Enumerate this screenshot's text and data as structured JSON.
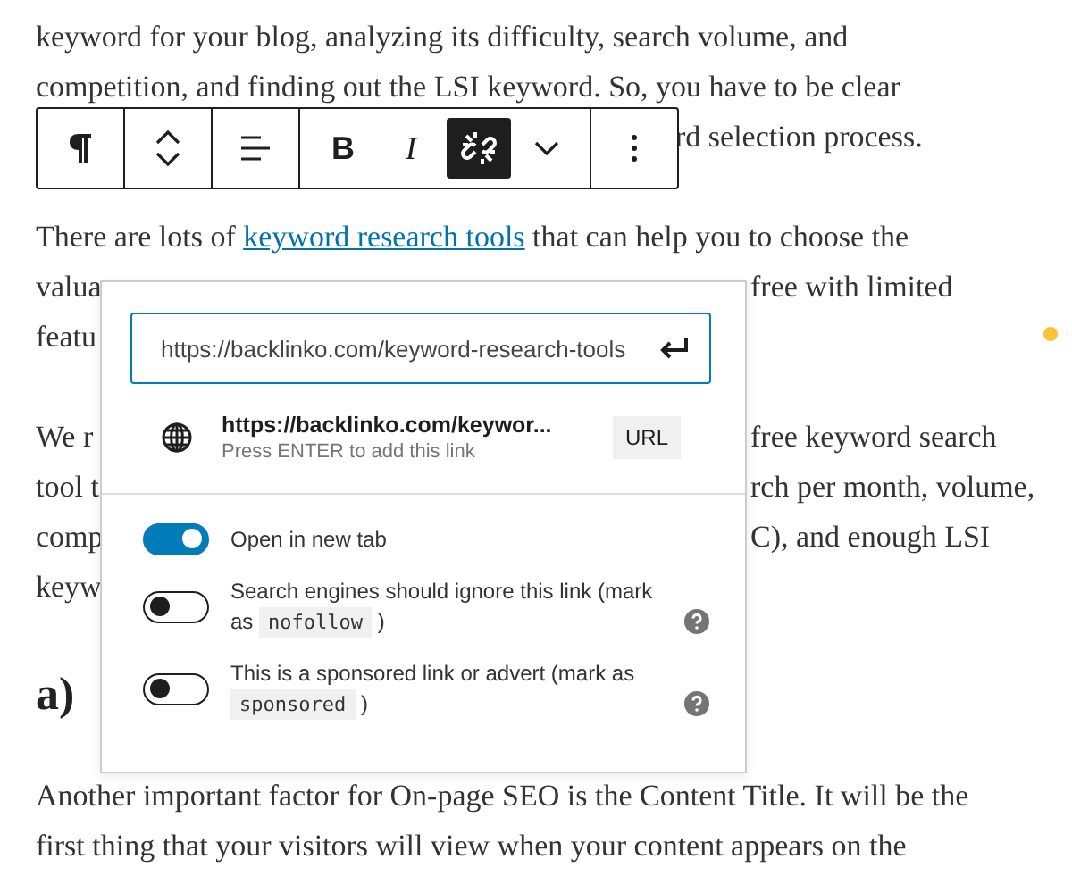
{
  "article": {
    "paragraphs": [
      {
        "lines": [
          {
            "kind": "full",
            "text": "keyword for your blog, analyzing its difficulty, search volume, and"
          },
          {
            "kind": "full",
            "text": "competition, and finding out the LSI keyword. So, you have to be clear"
          },
          {
            "kind": "after_toolbar",
            "right": "rd selection process."
          }
        ]
      },
      {
        "lines": [
          {
            "kind": "link",
            "before": "There are lots of ",
            "link": "keyword research tools",
            "after": " that can help you to choose the"
          },
          {
            "kind": "split",
            "left": "valua",
            "right": "free with limited"
          },
          {
            "kind": "split",
            "left": "featu"
          }
        ]
      },
      {
        "lines": [
          {
            "kind": "split",
            "left": "We r",
            "right": "free keyword search"
          },
          {
            "kind": "split",
            "left": "tool t",
            "right": "rch per month, volume,"
          },
          {
            "kind": "split",
            "left": "comp",
            "right": "C), and enough LSI"
          },
          {
            "kind": "split",
            "left": "keyw"
          }
        ]
      },
      {
        "heading": "a)"
      },
      {
        "lines": [
          {
            "kind": "full",
            "text": "Another important factor for On-page SEO is the Content Title. It will be the"
          },
          {
            "kind": "full",
            "text": "first thing that your visitors will view when your content appears on the"
          }
        ]
      }
    ]
  },
  "toolbar": {
    "format_buttons": [
      {
        "kind": "bold",
        "label": "B",
        "selected": false
      },
      {
        "kind": "italic",
        "label": "I",
        "selected": false
      },
      {
        "kind": "link",
        "selected": true
      }
    ]
  },
  "link_popover": {
    "url_input": {
      "value": "https://backlinko.com/keyword-research-tools"
    },
    "suggestion": {
      "title": "https://backlinko.com/keywor...",
      "hint": "Press ENTER to add this link",
      "type": "URL"
    },
    "settings": [
      {
        "text": "Open in new tab",
        "on": true
      },
      {
        "text": "Search engines should ignore this link (mark as ",
        "code": "nofollow",
        "after": " )",
        "on": false,
        "help": true
      },
      {
        "text": "This is a sponsored link or advert (mark as ",
        "code": "sponsored",
        "after": " )",
        "on": false,
        "help": true
      }
    ]
  }
}
